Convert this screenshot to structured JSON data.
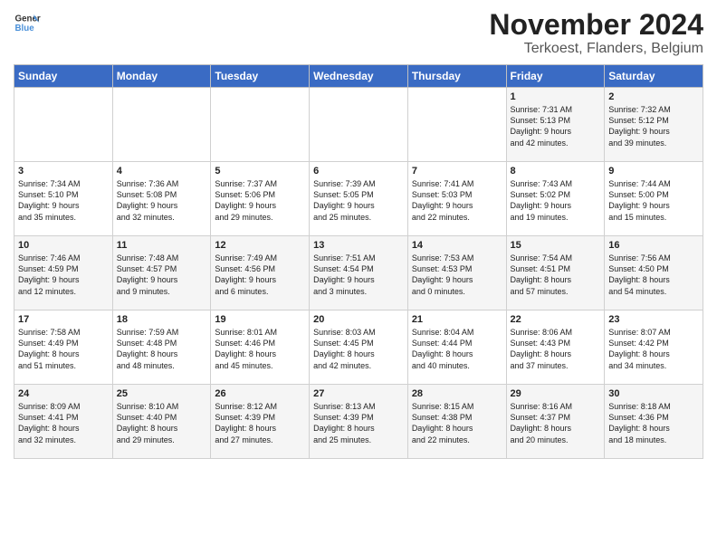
{
  "header": {
    "logo_general": "General",
    "logo_blue": "Blue",
    "title": "November 2024",
    "subtitle": "Terkoest, Flanders, Belgium"
  },
  "columns": [
    "Sunday",
    "Monday",
    "Tuesday",
    "Wednesday",
    "Thursday",
    "Friday",
    "Saturday"
  ],
  "weeks": [
    [
      {
        "day": "",
        "info": ""
      },
      {
        "day": "",
        "info": ""
      },
      {
        "day": "",
        "info": ""
      },
      {
        "day": "",
        "info": ""
      },
      {
        "day": "",
        "info": ""
      },
      {
        "day": "1",
        "info": "Sunrise: 7:31 AM\nSunset: 5:13 PM\nDaylight: 9 hours\nand 42 minutes."
      },
      {
        "day": "2",
        "info": "Sunrise: 7:32 AM\nSunset: 5:12 PM\nDaylight: 9 hours\nand 39 minutes."
      }
    ],
    [
      {
        "day": "3",
        "info": "Sunrise: 7:34 AM\nSunset: 5:10 PM\nDaylight: 9 hours\nand 35 minutes."
      },
      {
        "day": "4",
        "info": "Sunrise: 7:36 AM\nSunset: 5:08 PM\nDaylight: 9 hours\nand 32 minutes."
      },
      {
        "day": "5",
        "info": "Sunrise: 7:37 AM\nSunset: 5:06 PM\nDaylight: 9 hours\nand 29 minutes."
      },
      {
        "day": "6",
        "info": "Sunrise: 7:39 AM\nSunset: 5:05 PM\nDaylight: 9 hours\nand 25 minutes."
      },
      {
        "day": "7",
        "info": "Sunrise: 7:41 AM\nSunset: 5:03 PM\nDaylight: 9 hours\nand 22 minutes."
      },
      {
        "day": "8",
        "info": "Sunrise: 7:43 AM\nSunset: 5:02 PM\nDaylight: 9 hours\nand 19 minutes."
      },
      {
        "day": "9",
        "info": "Sunrise: 7:44 AM\nSunset: 5:00 PM\nDaylight: 9 hours\nand 15 minutes."
      }
    ],
    [
      {
        "day": "10",
        "info": "Sunrise: 7:46 AM\nSunset: 4:59 PM\nDaylight: 9 hours\nand 12 minutes."
      },
      {
        "day": "11",
        "info": "Sunrise: 7:48 AM\nSunset: 4:57 PM\nDaylight: 9 hours\nand 9 minutes."
      },
      {
        "day": "12",
        "info": "Sunrise: 7:49 AM\nSunset: 4:56 PM\nDaylight: 9 hours\nand 6 minutes."
      },
      {
        "day": "13",
        "info": "Sunrise: 7:51 AM\nSunset: 4:54 PM\nDaylight: 9 hours\nand 3 minutes."
      },
      {
        "day": "14",
        "info": "Sunrise: 7:53 AM\nSunset: 4:53 PM\nDaylight: 9 hours\nand 0 minutes."
      },
      {
        "day": "15",
        "info": "Sunrise: 7:54 AM\nSunset: 4:51 PM\nDaylight: 8 hours\nand 57 minutes."
      },
      {
        "day": "16",
        "info": "Sunrise: 7:56 AM\nSunset: 4:50 PM\nDaylight: 8 hours\nand 54 minutes."
      }
    ],
    [
      {
        "day": "17",
        "info": "Sunrise: 7:58 AM\nSunset: 4:49 PM\nDaylight: 8 hours\nand 51 minutes."
      },
      {
        "day": "18",
        "info": "Sunrise: 7:59 AM\nSunset: 4:48 PM\nDaylight: 8 hours\nand 48 minutes."
      },
      {
        "day": "19",
        "info": "Sunrise: 8:01 AM\nSunset: 4:46 PM\nDaylight: 8 hours\nand 45 minutes."
      },
      {
        "day": "20",
        "info": "Sunrise: 8:03 AM\nSunset: 4:45 PM\nDaylight: 8 hours\nand 42 minutes."
      },
      {
        "day": "21",
        "info": "Sunrise: 8:04 AM\nSunset: 4:44 PM\nDaylight: 8 hours\nand 40 minutes."
      },
      {
        "day": "22",
        "info": "Sunrise: 8:06 AM\nSunset: 4:43 PM\nDaylight: 8 hours\nand 37 minutes."
      },
      {
        "day": "23",
        "info": "Sunrise: 8:07 AM\nSunset: 4:42 PM\nDaylight: 8 hours\nand 34 minutes."
      }
    ],
    [
      {
        "day": "24",
        "info": "Sunrise: 8:09 AM\nSunset: 4:41 PM\nDaylight: 8 hours\nand 32 minutes."
      },
      {
        "day": "25",
        "info": "Sunrise: 8:10 AM\nSunset: 4:40 PM\nDaylight: 8 hours\nand 29 minutes."
      },
      {
        "day": "26",
        "info": "Sunrise: 8:12 AM\nSunset: 4:39 PM\nDaylight: 8 hours\nand 27 minutes."
      },
      {
        "day": "27",
        "info": "Sunrise: 8:13 AM\nSunset: 4:39 PM\nDaylight: 8 hours\nand 25 minutes."
      },
      {
        "day": "28",
        "info": "Sunrise: 8:15 AM\nSunset: 4:38 PM\nDaylight: 8 hours\nand 22 minutes."
      },
      {
        "day": "29",
        "info": "Sunrise: 8:16 AM\nSunset: 4:37 PM\nDaylight: 8 hours\nand 20 minutes."
      },
      {
        "day": "30",
        "info": "Sunrise: 8:18 AM\nSunset: 4:36 PM\nDaylight: 8 hours\nand 18 minutes."
      }
    ]
  ]
}
